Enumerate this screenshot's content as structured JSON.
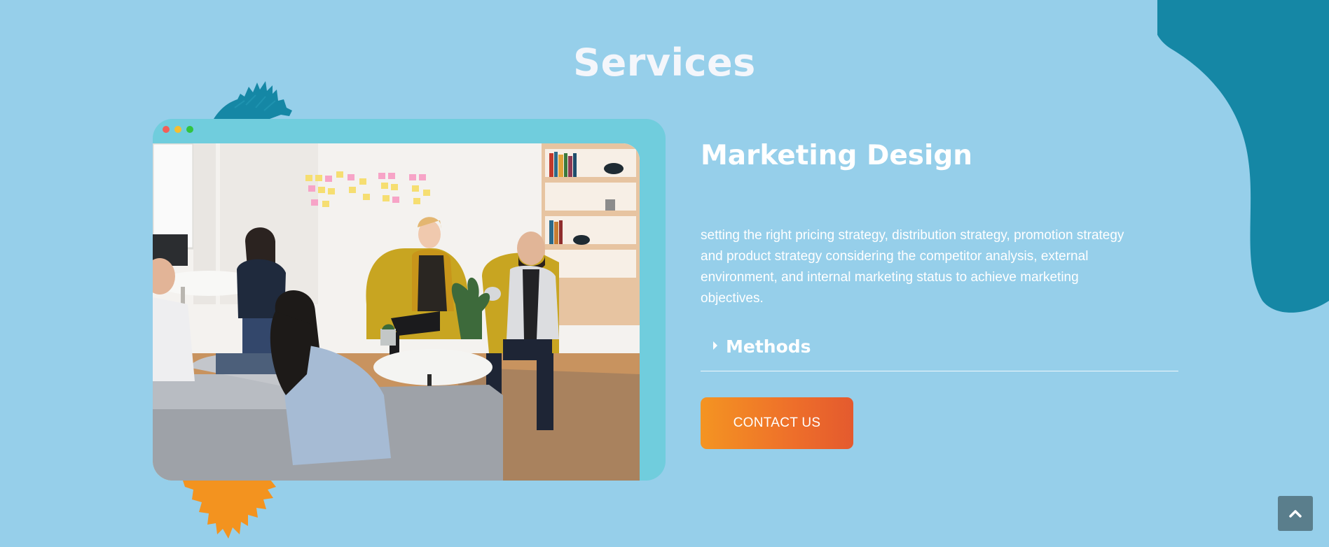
{
  "header": {
    "title": "Services"
  },
  "service": {
    "title": "Marketing Design",
    "description": "setting the right pricing strategy, distribution strategy, promotion strategy and product strategy considering the competitor analysis, external environment, and internal marketing status to achieve marketing objectives.",
    "accordion": {
      "label": "Methods",
      "expanded": false
    },
    "cta_label": "CONTACT US"
  },
  "window_dots": {
    "colors": [
      "#f25f58",
      "#f6be2f",
      "#30c440"
    ]
  },
  "scroll_top": {
    "icon": "chevron-up-icon"
  },
  "colors": {
    "background": "#96cfea",
    "blob": "#1587a5",
    "frame": "#70cddd",
    "brush_top": "#1587a5",
    "brush_bottom": "#f3931f",
    "cta_start": "#f49422",
    "cta_end": "#e45a2e",
    "scroll_button": "#5a7e8c"
  }
}
